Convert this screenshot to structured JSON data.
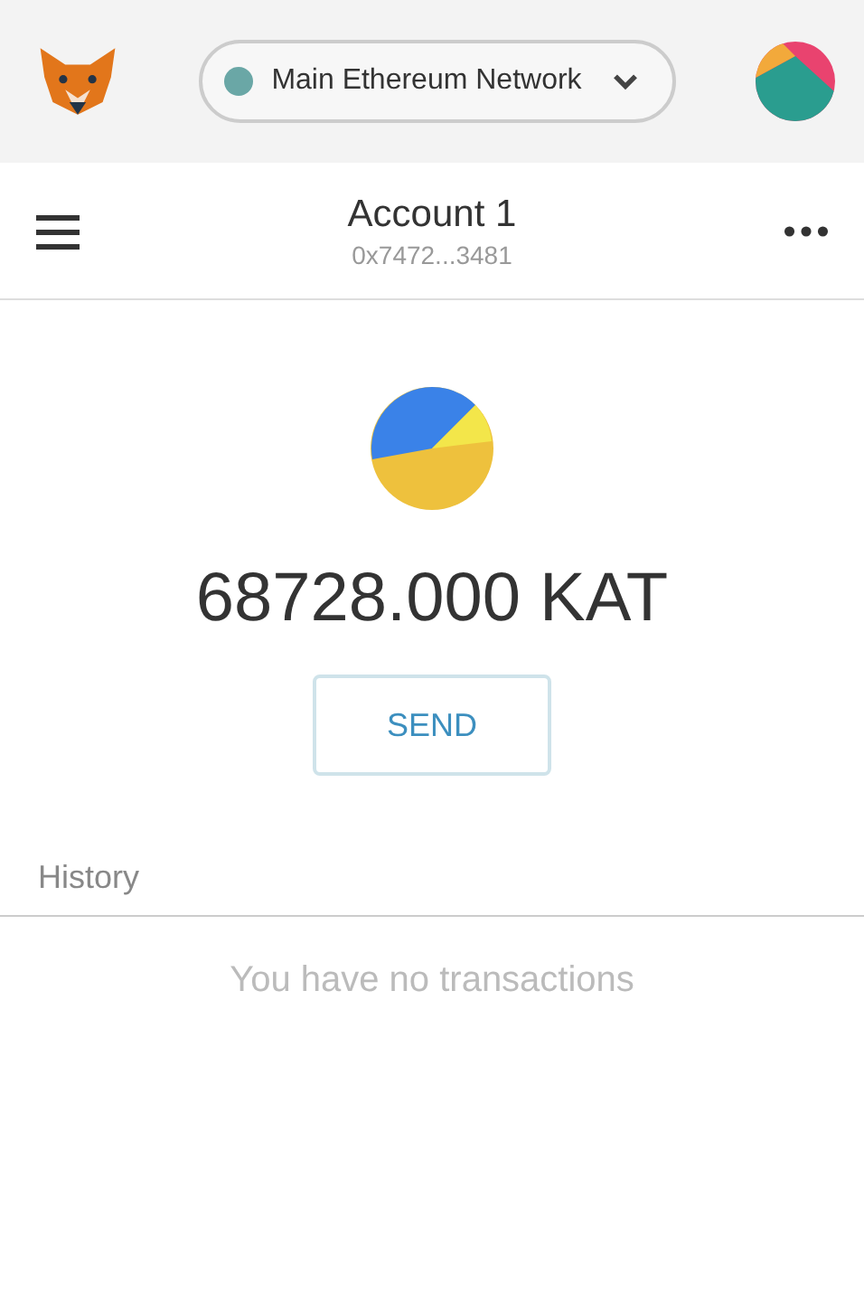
{
  "top_bar": {
    "network": {
      "label": "Main Ethereum Network"
    }
  },
  "account": {
    "name": "Account 1",
    "address": "0x7472...3481"
  },
  "balance": "68728.000 KAT",
  "buttons": [
    {
      "kind": "send",
      "label": "SEND"
    }
  ],
  "history": {
    "heading": "History",
    "empty_message": "You have no transactions"
  }
}
